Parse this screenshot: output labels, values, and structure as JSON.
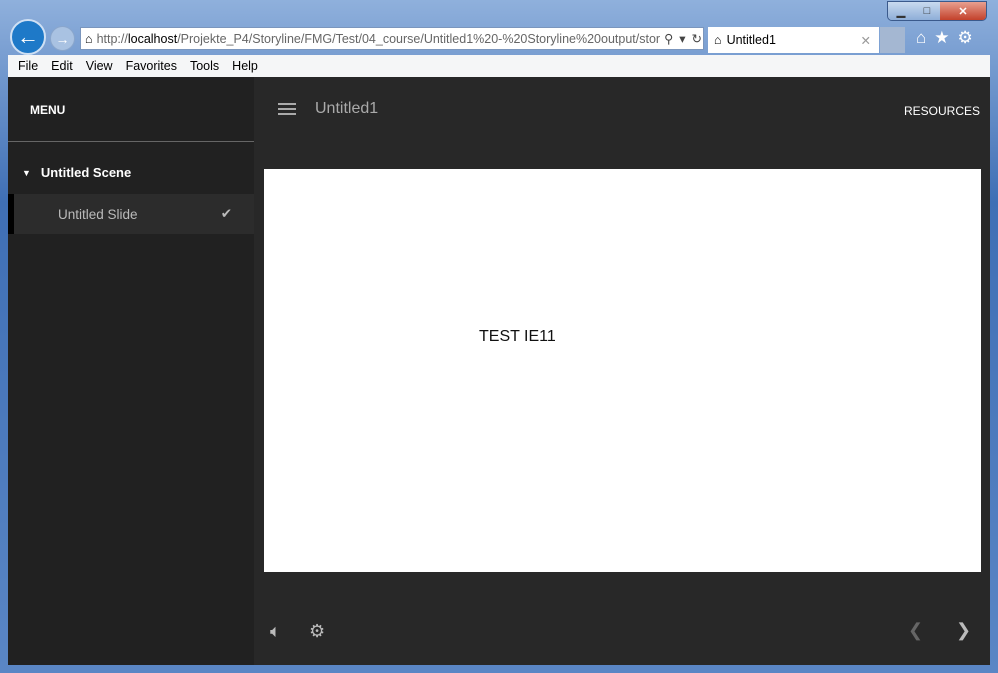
{
  "browser": {
    "url_host": "localhost",
    "url_prefix": "http://",
    "url_path": "/Projekte_P4/Storyline/FMG/Test/04_course/Untitled1%20-%20Storyline%20output/stor",
    "tab_title": "Untitled1",
    "menu": [
      "File",
      "Edit",
      "View",
      "Favorites",
      "Tools",
      "Help"
    ]
  },
  "player": {
    "menu_label": "MENU",
    "scene": "Untitled Scene",
    "slide": "Untitled Slide",
    "title": "Untitled1",
    "resources": "RESOURCES",
    "slide_text": "TEST IE11"
  }
}
